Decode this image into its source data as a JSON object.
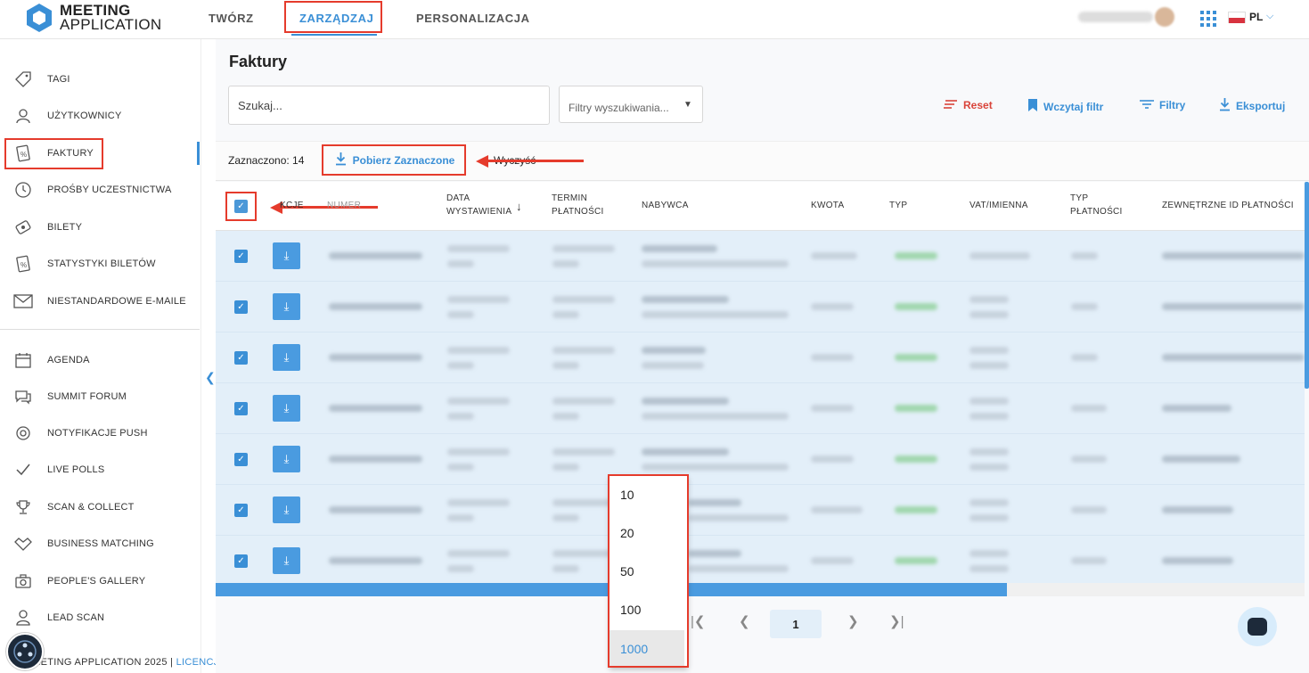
{
  "logo": {
    "line1": "MEETING",
    "line2": "APPLICATION"
  },
  "topnav": {
    "create": "TWÓRZ",
    "manage": "ZARZĄDZAJ",
    "personalize": "PERSONALIZACJA"
  },
  "lang": "PL",
  "colors": {
    "accent": "#3a8fd6",
    "annotation": "#e53b2c",
    "row_selected": "#e3eff9"
  },
  "sidebar": {
    "items": [
      {
        "label": "TAGI",
        "icon": "tag-icon"
      },
      {
        "label": "UŻYTKOWNICY",
        "icon": "user-icon"
      },
      {
        "label": "FAKTURY",
        "icon": "invoice-icon"
      },
      {
        "label": "PROŚBY UCZESTNICTWA",
        "icon": "clock-icon"
      },
      {
        "label": "BILETY",
        "icon": "ticket-icon"
      },
      {
        "label": "STATYSTYKI BILETÓW",
        "icon": "ticket-stats-icon"
      },
      {
        "label": "NIESTANDARDOWE E-MAILE",
        "icon": "mail-icon"
      },
      {
        "label": "AGENDA",
        "icon": "calendar-icon"
      },
      {
        "label": "SUMMIT FORUM",
        "icon": "chat-icon"
      },
      {
        "label": "NOTYFIKACJE PUSH",
        "icon": "push-icon"
      },
      {
        "label": "LIVE POLLS",
        "icon": "check-icon"
      },
      {
        "label": "SCAN & COLLECT",
        "icon": "trophy-icon"
      },
      {
        "label": "BUSINESS MATCHING",
        "icon": "handshake-icon"
      },
      {
        "label": "PEOPLE'S GALLERY",
        "icon": "camera-icon"
      },
      {
        "label": "LEAD SCAN",
        "icon": "person-icon"
      }
    ]
  },
  "footer": {
    "text": "EETING APPLICATION 2025 | ",
    "licenses": "LICENCJE"
  },
  "page": {
    "title": "Faktury"
  },
  "search": {
    "placeholder": "Szukaj..."
  },
  "filters_select": {
    "placeholder": "Filtry wyszukiwania..."
  },
  "toolbar": {
    "reset": "Reset",
    "load_filter": "Wczytaj filtr",
    "filters": "Filtry",
    "export": "Eksportuj"
  },
  "selection": {
    "count_label": "Zaznaczono: 14",
    "download_selected": "Pobierz Zaznaczone",
    "clear": "Wyczyść"
  },
  "table": {
    "headers": {
      "actions": "KCJE",
      "number": "NUMER",
      "issue_date_1": "DATA",
      "issue_date_2": "WYSTAWIENIA",
      "due_1": "TERMIN",
      "due_2": "PŁATNOŚCI",
      "buyer": "NABYWCA",
      "amount": "KWOTA",
      "type": "TYP",
      "vat": "VAT/IMIENNA",
      "pay_type_1": "TYP",
      "pay_type_2": "PŁATNOŚCI",
      "external_id": "ZEWNĘTRZNE ID PŁATNOŚCI"
    }
  },
  "pagination": {
    "current": "1"
  },
  "page_size_options": [
    "10",
    "20",
    "50",
    "100",
    "1000"
  ],
  "page_size_selected": "1000"
}
